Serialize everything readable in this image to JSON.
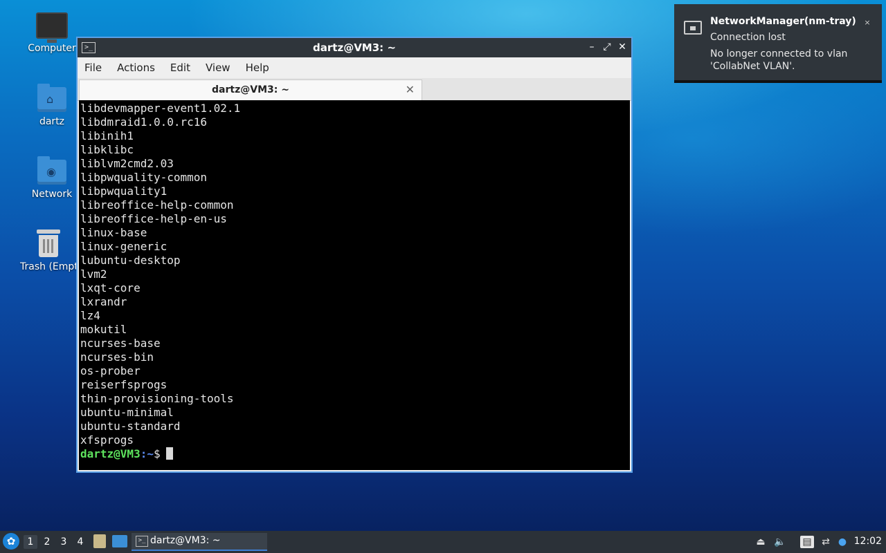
{
  "desktop": {
    "icons": [
      {
        "label": "Computer",
        "icon": "computer-icon"
      },
      {
        "label": "dartz",
        "icon": "home-folder-icon"
      },
      {
        "label": "Network",
        "icon": "network-folder-icon"
      },
      {
        "label": "Trash (Empty)",
        "icon": "trash-icon"
      }
    ]
  },
  "window": {
    "title": "dartz@VM3: ~",
    "controls": {
      "minimize": "–",
      "maximize": "⤢",
      "close": "✕"
    },
    "menu": [
      "File",
      "Actions",
      "Edit",
      "View",
      "Help"
    ],
    "tab": {
      "title": "dartz@VM3: ~",
      "close": "✕"
    }
  },
  "terminal": {
    "lines": [
      "libdevmapper-event1.02.1",
      "libdmraid1.0.0.rc16",
      "libinih1",
      "libklibc",
      "liblvm2cmd2.03",
      "libpwquality-common",
      "libpwquality1",
      "libreoffice-help-common",
      "libreoffice-help-en-us",
      "linux-base",
      "linux-generic",
      "lubuntu-desktop",
      "lvm2",
      "lxqt-core",
      "lxrandr",
      "lz4",
      "mokutil",
      "ncurses-base",
      "ncurses-bin",
      "os-prober",
      "reiserfsprogs",
      "thin-provisioning-tools",
      "ubuntu-minimal",
      "ubuntu-standard",
      "xfsprogs"
    ],
    "prompt": {
      "user": "dartz@VM3",
      "sep": ":",
      "path": "~",
      "symbol": "$"
    }
  },
  "notification": {
    "title": "NetworkManager(nm-tray)",
    "summary": "Connection lost",
    "body": "No longer connected to vlan 'CollabNet VLAN'.",
    "close": "×"
  },
  "taskbar": {
    "desktops": [
      "1",
      "2",
      "3",
      "4"
    ],
    "active_desktop": "1",
    "task_label": "dartz@VM3: ~",
    "clock": "12:02"
  }
}
